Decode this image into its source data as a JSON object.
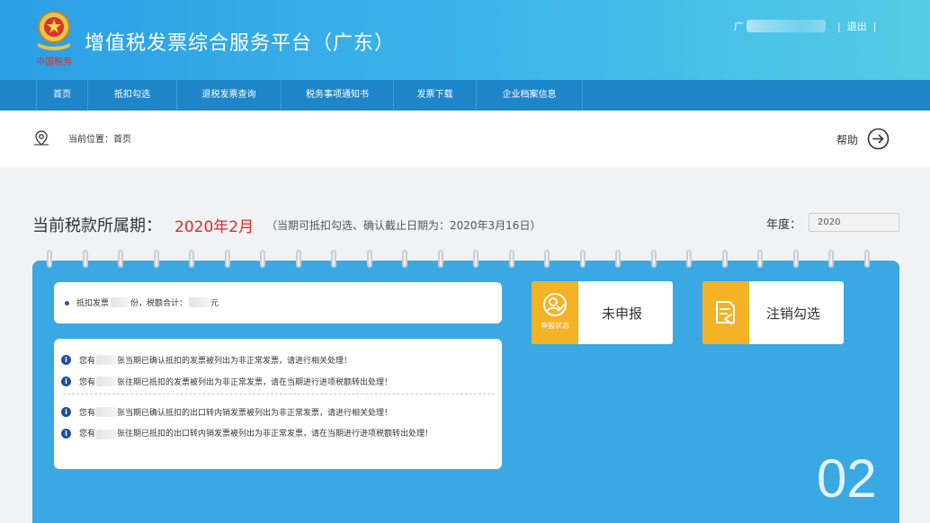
{
  "header": {
    "title": "增值税发票综合服务平台（广东）",
    "emblem_caption": "中国税务",
    "user_prefix": "广",
    "logout_label": "退出",
    "separator": "|"
  },
  "nav": {
    "items": [
      {
        "label": "首页"
      },
      {
        "label": "抵扣勾选"
      },
      {
        "label": "退税发票查询"
      },
      {
        "label": "税务事项通知书"
      },
      {
        "label": "发票下载"
      },
      {
        "label": "企业档案信息"
      }
    ]
  },
  "breadcrumb": {
    "text": "当前位置：首页",
    "help_label": "帮助"
  },
  "period": {
    "label": "当前税款所属期：",
    "value": "2020年2月",
    "note": "（当期可抵扣勾选、确认截止日期为：2020年3月16日）",
    "year_label": "年度：",
    "year_value": "2020"
  },
  "summary": {
    "prefix": "抵扣发票",
    "count_unit": "份，税额合计：",
    "amount_unit": "元"
  },
  "notices": [
    {
      "pre": "您有",
      "text": "张当期已确认抵扣的发票被列出为非正常发票，请进行相关处理！"
    },
    {
      "pre": "您有",
      "text": "张往期已抵扣的发票被列出为非正常发票，请在当期进行进项税额转出处理！"
    },
    {
      "pre": "您有",
      "text": "张当期已确认抵扣的出口转内销发票被列出为非正常发票，请进行相关处理！"
    },
    {
      "pre": "您有",
      "text": "张往期已抵扣的出口转内销发票被列出为非正常发票，请在当期进行进项税额转出处理！"
    }
  ],
  "status_card": {
    "icon_label": "申报状态",
    "value": "未申报"
  },
  "cancel_card": {
    "label": "注销勾选"
  },
  "panel": {
    "page_number": "02"
  },
  "colors": {
    "header_blue": "#2b9fe4",
    "nav_blue": "#1e86c8",
    "panel_blue": "#3aa8e3",
    "accent_orange": "#f4b225",
    "period_red": "#e22a25",
    "notice_icon": "#1e4f9c"
  },
  "icons": [
    "emblem-icon",
    "location-icon",
    "arrow-right-circle-icon",
    "status-person-icon",
    "cancel-doc-icon",
    "info-icon"
  ]
}
